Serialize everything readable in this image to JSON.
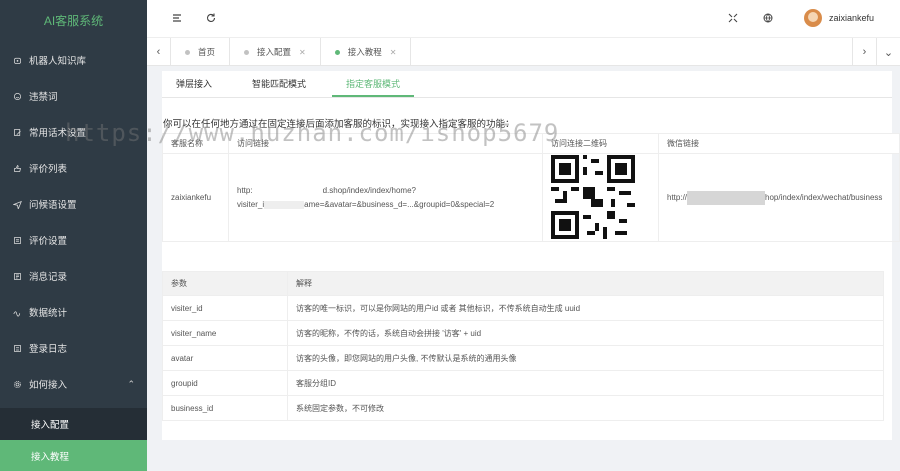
{
  "sidebar": {
    "brand": "AI客服系统",
    "items": [
      {
        "label": "机器人知识库",
        "icon": "robot-icon"
      },
      {
        "label": "违禁词",
        "icon": "smile-icon"
      },
      {
        "label": "常用话术设置",
        "icon": "edit-icon"
      },
      {
        "label": "评价列表",
        "icon": "thumb-icon"
      },
      {
        "label": "问候语设置",
        "icon": "send-icon"
      },
      {
        "label": "评价设置",
        "icon": "list-icon"
      },
      {
        "label": "消息记录",
        "icon": "message-icon"
      },
      {
        "label": "数据统计",
        "icon": "chart-icon"
      },
      {
        "label": "登录日志",
        "icon": "log-icon"
      },
      {
        "label": "如何接入",
        "icon": "gear-icon"
      }
    ],
    "submenu": [
      {
        "label": "接入配置"
      },
      {
        "label": "接入教程"
      }
    ]
  },
  "topbar": {
    "username": "zaixiankefu"
  },
  "tabs": [
    {
      "label": "首页"
    },
    {
      "label": "接入配置"
    },
    {
      "label": "接入教程"
    }
  ],
  "subtabs": [
    {
      "label": "弹层接入"
    },
    {
      "label": "智能匹配模式"
    },
    {
      "label": "指定客服模式"
    }
  ],
  "content": {
    "description": "你可以在任何地方通过在固定连接后面添加客服的标识，实现接入指定客服的功能：",
    "table1": {
      "headers": [
        "客服名称",
        "访问链接",
        "访问连接二维码",
        "微信链接"
      ],
      "row": {
        "name": "zaixiankefu",
        "link_line1": "http:",
        "link_line1_b": "d.shop/index/index/home?",
        "link_line2": "visiter_i",
        "link_line2_b": "ame=&avatar=&business",
        "link_line2_c": "_d=...&groupid=0&special=2",
        "wechat_a": "http://",
        "wechat_b": "hop/index/index/wechat/business"
      }
    },
    "table2": {
      "headers": [
        "参数",
        "解释"
      ],
      "rows": [
        {
          "param": "visiter_id",
          "desc": "访客的唯一标识，可以是你网站的用户id 或者 其他标识，不传系统自动生成 uuid"
        },
        {
          "param": "visiter_name",
          "desc": "访客的昵称，不传的话，系统自动会拼接 '访客' + uid"
        },
        {
          "param": "avatar",
          "desc": "访客的头像，即您网站的用户头像, 不传默认是系统的通用头像"
        },
        {
          "param": "groupid",
          "desc": "客服分组ID"
        },
        {
          "param": "business_id",
          "desc": "系统固定参数，不可修改"
        }
      ]
    }
  },
  "watermark": "https://www.huzhan.com/ishop5679",
  "colors": {
    "accent": "#5fb878",
    "sidebar": "#2f3b45",
    "submenu": "#252e36"
  }
}
